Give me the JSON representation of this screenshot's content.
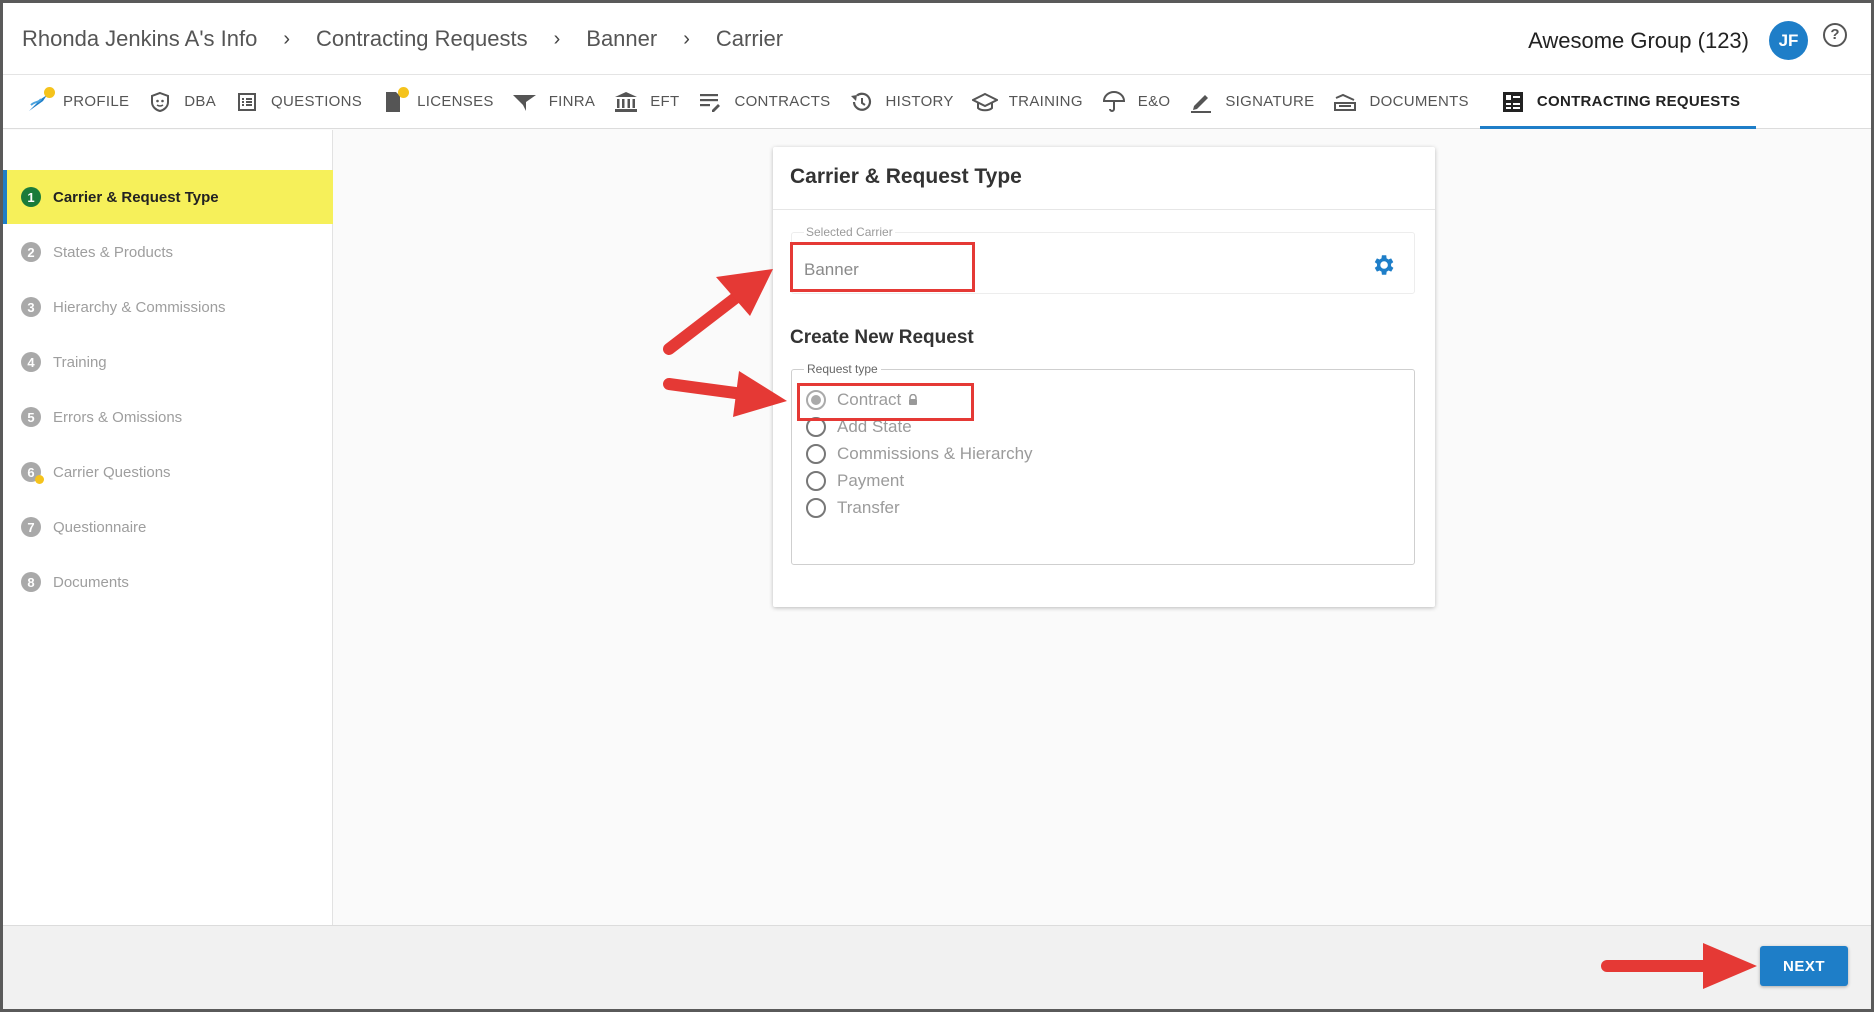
{
  "breadcrumb": [
    "Rhonda Jenkins A's Info",
    "Contracting Requests",
    "Banner",
    "Carrier"
  ],
  "account": {
    "group": "Awesome Group (123)",
    "initials": "JF",
    "help": "?"
  },
  "tabs": [
    {
      "label": "PROFILE",
      "icon": "profile-icon"
    },
    {
      "label": "DBA",
      "icon": "shield-icon"
    },
    {
      "label": "QUESTIONS",
      "icon": "list-icon"
    },
    {
      "label": "LICENSES",
      "icon": "license-icon"
    },
    {
      "label": "FINRA",
      "icon": "finra-icon"
    },
    {
      "label": "EFT",
      "icon": "bank-icon"
    },
    {
      "label": "CONTRACTS",
      "icon": "document-lines-icon"
    },
    {
      "label": "HISTORY",
      "icon": "history-icon"
    },
    {
      "label": "TRAINING",
      "icon": "graduation-cap-icon"
    },
    {
      "label": "E&O",
      "icon": "umbrella-icon"
    },
    {
      "label": "SIGNATURE",
      "icon": "pen-icon"
    },
    {
      "label": "DOCUMENTS",
      "icon": "tray-icon"
    },
    {
      "label": "CONTRACTING REQUESTS",
      "icon": "request-icon"
    }
  ],
  "steps": [
    {
      "num": "1",
      "label": "Carrier & Request Type"
    },
    {
      "num": "2",
      "label": "States & Products"
    },
    {
      "num": "3",
      "label": "Hierarchy & Commissions"
    },
    {
      "num": "4",
      "label": "Training"
    },
    {
      "num": "5",
      "label": "Errors & Omissions"
    },
    {
      "num": "6",
      "label": "Carrier Questions"
    },
    {
      "num": "7",
      "label": "Questionnaire"
    },
    {
      "num": "8",
      "label": "Documents"
    }
  ],
  "card": {
    "title": "Carrier & Request Type",
    "carrier_label": "Selected Carrier",
    "carrier_value": "Banner",
    "section_title": "Create New Request",
    "request_legend": "Request type",
    "options": [
      "Contract",
      "Add State",
      "Commissions & Hierarchy",
      "Payment",
      "Transfer"
    ],
    "selected": "Contract"
  },
  "footer": {
    "next_label": "NEXT"
  },
  "colors": {
    "accent": "#1e7ec8",
    "active_step": "#f6f05a",
    "highlight": "#e53935"
  }
}
